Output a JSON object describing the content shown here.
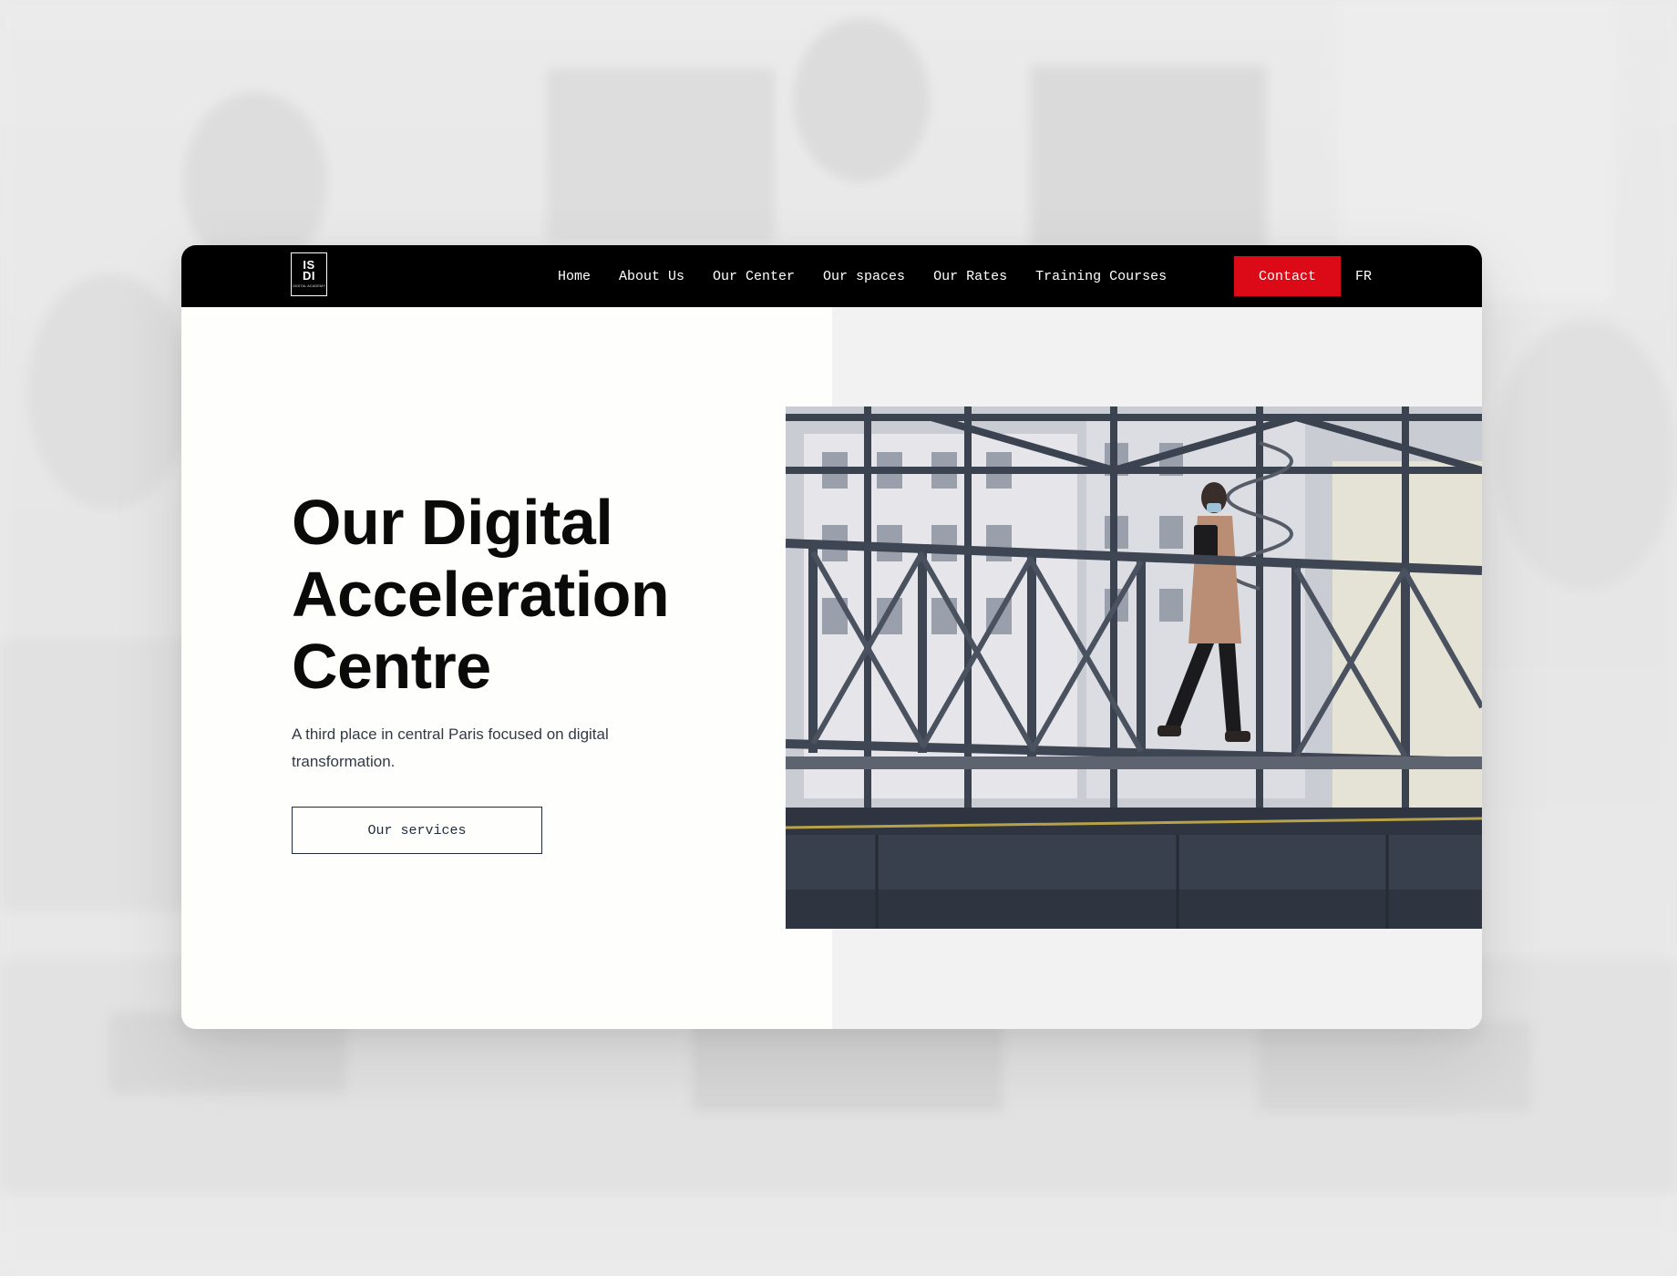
{
  "logo": {
    "line1": "IS",
    "line2": "DI",
    "tagline": "DIGITAL ACADEMY"
  },
  "nav": {
    "items": [
      {
        "label": "Home"
      },
      {
        "label": "About Us"
      },
      {
        "label": "Our Center"
      },
      {
        "label": "Our spaces"
      },
      {
        "label": "Our Rates"
      },
      {
        "label": "Training Courses"
      }
    ],
    "contact_label": "Contact",
    "language_label": "FR"
  },
  "hero": {
    "title": "Our Digital Acceleration Centre",
    "subtitle": "A third place in central Paris focused on digital transformation.",
    "cta_label": "Our services",
    "image_alt": "Woman wearing a mask walking across a metal footbridge inside a glass atrium"
  },
  "colors": {
    "navbar_bg": "#000000",
    "accent_red": "#dc0a16",
    "hero_bg_left": "#fefefc",
    "hero_bg_right": "#f1f2f1",
    "text_dark": "#0a0a0a",
    "text_muted": "#333a45"
  }
}
